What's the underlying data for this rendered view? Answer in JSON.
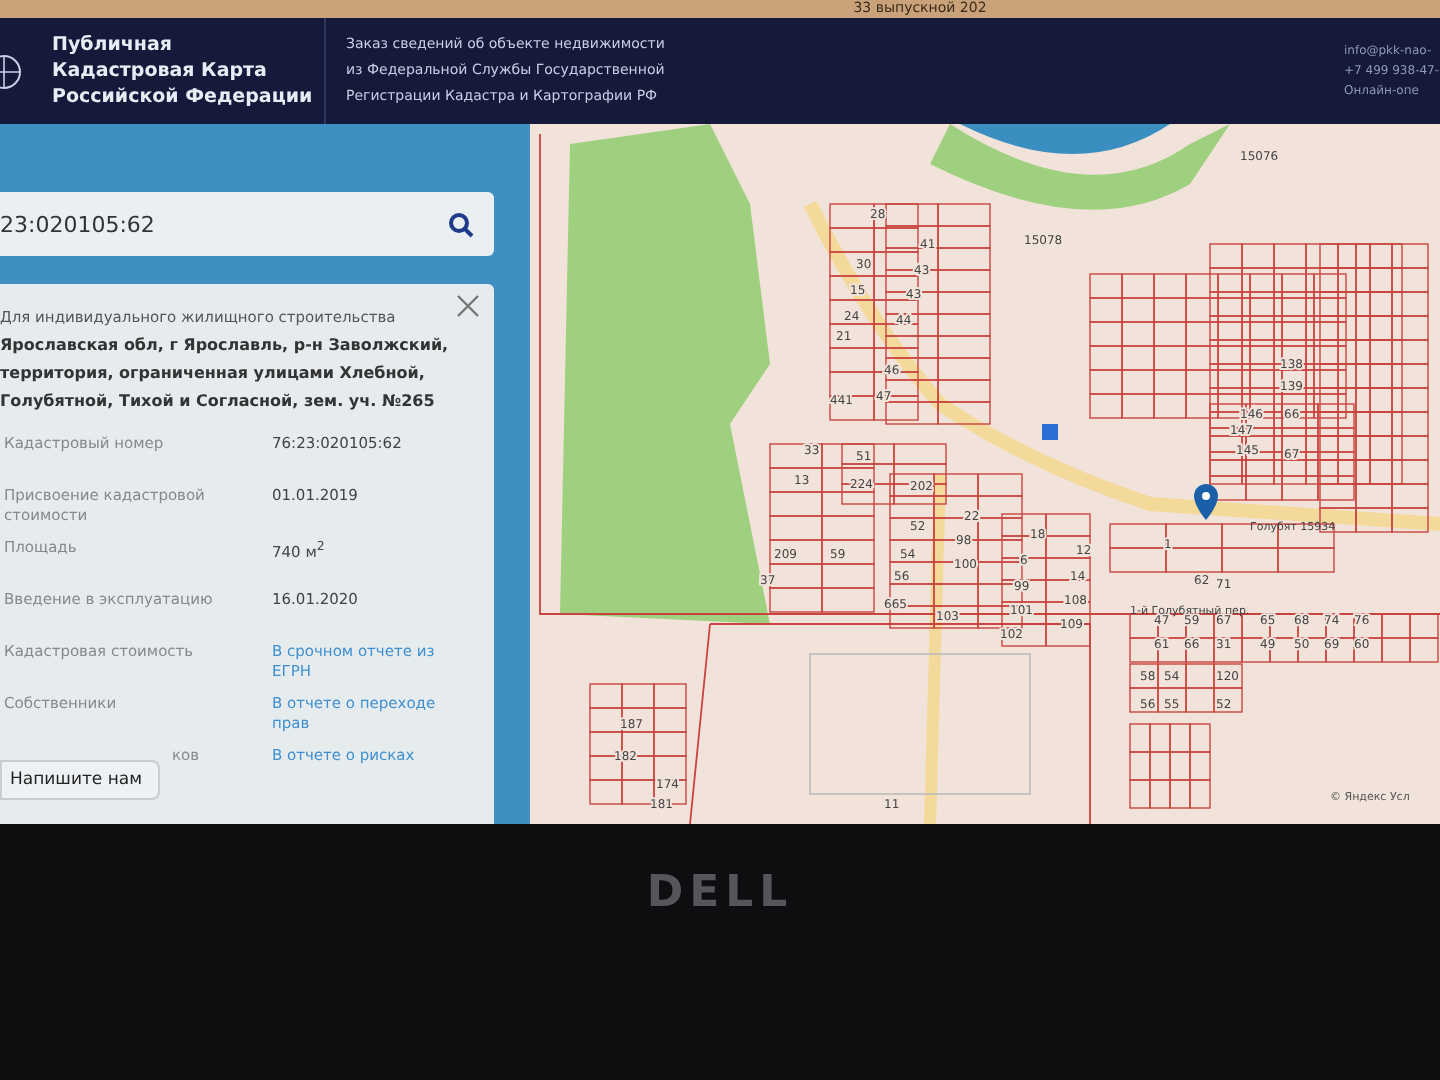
{
  "browser_strip": {
    "tab_text": "33 выпускной 202"
  },
  "header": {
    "title_lines": [
      "Публичная",
      "Кадастровая Карта",
      "Российской Федерации"
    ],
    "order_lines": [
      "Заказ сведений об объекте недвижимости",
      "из Федеральной Службы Государственной",
      "Регистрации Кадастра и Картографии РФ"
    ],
    "contacts": [
      "info@pkk-nao-",
      "+7 499 938-47-",
      "Онлайн-опе"
    ]
  },
  "search": {
    "value": "23:020105:62"
  },
  "card": {
    "purpose": "Для индивидуального жилищного строительства",
    "address": "Ярославская обл, г Ярославль, р-н Заволжский, территория, ограниченная улицами Хлебной, Голубятной, Тихой и Согласной, зем. уч. №265",
    "rows": [
      {
        "label": "Кадастровый номер",
        "value": "76:23:020105:62",
        "kind": "text"
      },
      {
        "label": "Присвоение кадастровой стоимости",
        "value": "01.01.2019",
        "kind": "text"
      },
      {
        "label": "Площадь",
        "value": "740 м$^{2}$",
        "kind": "text"
      },
      {
        "label": "Введение в эксплуатацию",
        "value": "16.01.2020",
        "kind": "text"
      },
      {
        "label": "Кадастровая стоимость",
        "value": "В срочном отчете из ЕГРН",
        "kind": "link"
      },
      {
        "label": "Собственники",
        "value": "В отчете о переходе прав",
        "kind": "link"
      },
      {
        "label": "ков",
        "value": "В отчете о рисках",
        "kind": "link"
      }
    ]
  },
  "chat_button": {
    "label": "Напишите нам"
  },
  "map": {
    "labels": [
      "15078",
      "15076",
      "28",
      "41",
      "30",
      "43",
      "15",
      "43",
      "24",
      "44",
      "21",
      "46",
      "441",
      "47",
      "33",
      "51",
      "13",
      "224",
      "202",
      "22",
      "18",
      "12",
      "52",
      "98",
      "54",
      "100",
      "6",
      "14",
      "209",
      "59",
      "37",
      "56",
      "99",
      "108",
      "665",
      "103",
      "101",
      "109",
      "102",
      "187",
      "182",
      "174",
      "181",
      "138",
      "139",
      "146",
      "147",
      "145",
      "66",
      "67",
      "47",
      "59",
      "67",
      "65",
      "68",
      "74",
      "76",
      "61",
      "66",
      "31",
      "49",
      "50",
      "69",
      "60",
      "58",
      "54",
      "120",
      "56",
      "55",
      "52",
      "1",
      "62",
      "71",
      "11"
    ],
    "streets": [
      "1-й Голубятный пер.",
      "Голубят 15934"
    ],
    "copyright": "© Яндекс Усл"
  },
  "laptop": {
    "logo": "DELL"
  }
}
